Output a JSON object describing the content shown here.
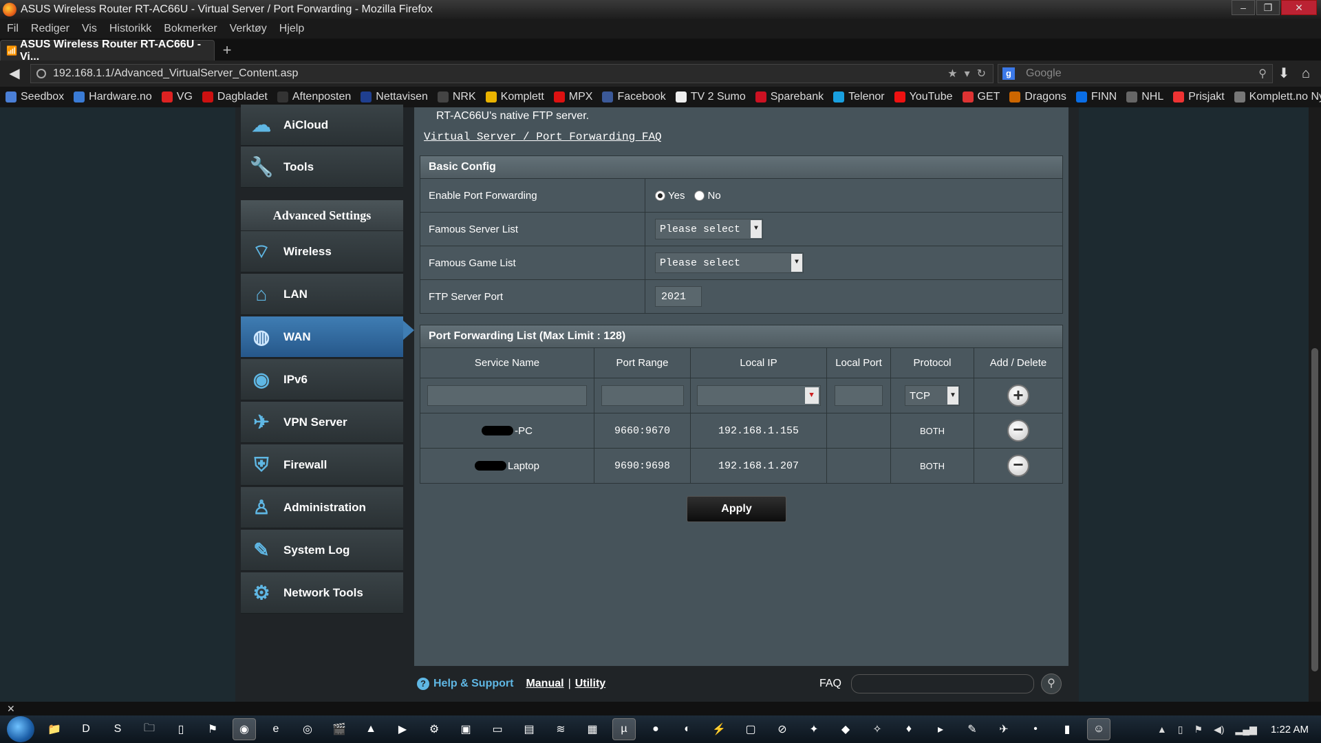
{
  "window": {
    "title": "ASUS Wireless Router RT-AC66U - Virtual Server / Port Forwarding - Mozilla Firefox",
    "controls": [
      "–",
      "❐",
      "✕"
    ]
  },
  "menu": [
    "Fil",
    "Rediger",
    "Vis",
    "Historikk",
    "Bokmerker",
    "Verktøy",
    "Hjelp"
  ],
  "tab": {
    "label": "ASUS Wireless Router RT-AC66U - Vi...",
    "new_tab": "+"
  },
  "nav": {
    "url": "192.168.1.1/Advanced_VirtualServer_Content.asp",
    "search_placeholder": "Google"
  },
  "bookmarks": [
    {
      "label": "Seedbox",
      "color": "#4a7fd6"
    },
    {
      "label": "Hardware.no",
      "color": "#3a7bd5"
    },
    {
      "label": "VG",
      "color": "#d22"
    },
    {
      "label": "Dagbladet",
      "color": "#c11"
    },
    {
      "label": "Aftenposten",
      "color": "#333"
    },
    {
      "label": "Nettavisen",
      "color": "#1f3f8f"
    },
    {
      "label": "NRK",
      "color": "#444"
    },
    {
      "label": "Komplett",
      "color": "#e9b300"
    },
    {
      "label": "MPX",
      "color": "#d11"
    },
    {
      "label": "Facebook",
      "color": "#3b5998"
    },
    {
      "label": "TV 2 Sumo",
      "color": "#eee"
    },
    {
      "label": "Sparebank",
      "color": "#c12"
    },
    {
      "label": "Telenor",
      "color": "#19a0e0"
    },
    {
      "label": "YouTube",
      "color": "#e11"
    },
    {
      "label": "GET",
      "color": "#d33"
    },
    {
      "label": "Dragons",
      "color": "#c60"
    },
    {
      "label": "FINN",
      "color": "#0a6ee6"
    },
    {
      "label": "NHL",
      "color": "#666"
    },
    {
      "label": "Prisjakt",
      "color": "#e33"
    },
    {
      "label": "Komplett.no Nye prod...",
      "color": "#777"
    }
  ],
  "sidebar": {
    "top_items": [
      {
        "label": "AiCloud",
        "icon": "cloud-icon"
      },
      {
        "label": "Tools",
        "icon": "wrench-icon"
      }
    ],
    "section_title": "Advanced Settings",
    "items": [
      {
        "label": "Wireless",
        "icon": "wifi-icon"
      },
      {
        "label": "LAN",
        "icon": "home-icon"
      },
      {
        "label": "WAN",
        "icon": "globe-icon",
        "active": true
      },
      {
        "label": "IPv6",
        "icon": "ipv6-icon"
      },
      {
        "label": "VPN Server",
        "icon": "vpn-icon"
      },
      {
        "label": "Firewall",
        "icon": "shield-icon"
      },
      {
        "label": "Administration",
        "icon": "admin-user-icon"
      },
      {
        "label": "System Log",
        "icon": "log-edit-icon"
      },
      {
        "label": "Network Tools",
        "icon": "network-tools-icon"
      }
    ]
  },
  "main": {
    "intro_text": "RT-AC66U's native FTP server.",
    "faq_link": "Virtual Server / Port Forwarding FAQ",
    "basic_config": {
      "title": "Basic Config",
      "enable_label": "Enable Port Forwarding",
      "yes": "Yes",
      "no": "No",
      "famous_server_label": "Famous Server List",
      "famous_server_value": "Please select",
      "famous_game_label": "Famous Game List",
      "famous_game_value": "Please select",
      "ftp_label": "FTP Server Port",
      "ftp_value": "2021"
    },
    "pf_list": {
      "title": "Port Forwarding List (Max Limit : 128)",
      "columns": [
        "Service Name",
        "Port Range",
        "Local IP",
        "Local Port",
        "Protocol",
        "Add / Delete"
      ],
      "new_row": {
        "protocol": "TCP"
      },
      "rows": [
        {
          "service": "-PC",
          "port_range": "9660:9670",
          "local_ip": "192.168.1.155",
          "local_port": "",
          "protocol": "BOTH"
        },
        {
          "service": "Laptop",
          "port_range": "9690:9698",
          "local_ip": "192.168.1.207",
          "local_port": "",
          "protocol": "BOTH"
        }
      ]
    },
    "apply": "Apply"
  },
  "footer": {
    "help": "Help & Support",
    "manual": "Manual",
    "separator": "|",
    "utility": "Utility",
    "faq": "FAQ"
  },
  "statusbar": {
    "close": "✕"
  },
  "taskbar": {
    "clock": "1:22 AM"
  }
}
